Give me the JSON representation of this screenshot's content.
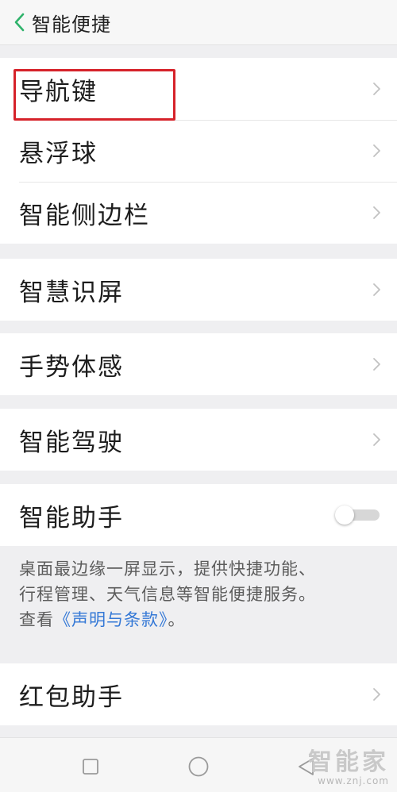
{
  "header": {
    "title": "智能便捷"
  },
  "groups": [
    {
      "items": [
        {
          "label": "导航键"
        },
        {
          "label": "悬浮球"
        },
        {
          "label": "智能侧边栏"
        }
      ]
    },
    {
      "items": [
        {
          "label": "智慧识屏"
        }
      ]
    },
    {
      "items": [
        {
          "label": "手势体感"
        }
      ]
    },
    {
      "items": [
        {
          "label": "智能驾驶"
        }
      ]
    },
    {
      "items": [
        {
          "label": "智能助手",
          "toggle": false
        }
      ]
    },
    {
      "items": [
        {
          "label": "红包助手"
        }
      ]
    }
  ],
  "assistant_desc": {
    "line1": "桌面最边缘一屏显示，提供快捷功能、",
    "line2": "行程管理、天气信息等智能便捷服务。",
    "line3_prefix": "查看",
    "link": "《声明与条款》",
    "line3_suffix": "。"
  },
  "watermark": {
    "logo": "智能家",
    "url": "www.znj.com"
  },
  "colors": {
    "accent": "#2fb36b",
    "link": "#3478d6",
    "highlight": "#d6222a"
  },
  "icons": [
    "chevron-left-icon",
    "chevron-right-icon",
    "square-icon",
    "circle-icon",
    "triangle-icon"
  ]
}
